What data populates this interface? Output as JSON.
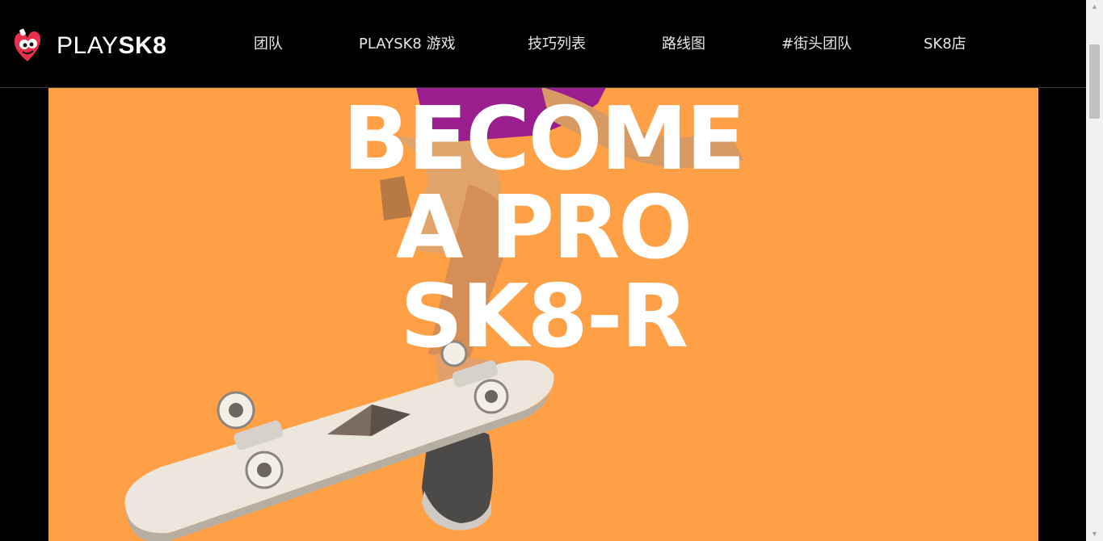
{
  "brand": {
    "name_light": "PLAY",
    "name_bold": "SK8",
    "logo_icon": "heart-mascot-icon",
    "accent": "#E8304E"
  },
  "nav": {
    "items": [
      {
        "label": "团队"
      },
      {
        "label": "PLAYSK8 游戏"
      },
      {
        "label": "技巧列表"
      },
      {
        "label": "路线图"
      },
      {
        "label": "#街头团队"
      },
      {
        "label": "SK8店"
      }
    ]
  },
  "hero": {
    "line1": "BECOME",
    "line2": "A PRO",
    "line3": "SK8-R",
    "background": "#FFA046",
    "board_emblem_icon": "ethereum-icon"
  },
  "scrollbar": {
    "up_icon": "scroll-up-arrow-icon",
    "down_icon": "scroll-down-arrow-icon"
  }
}
